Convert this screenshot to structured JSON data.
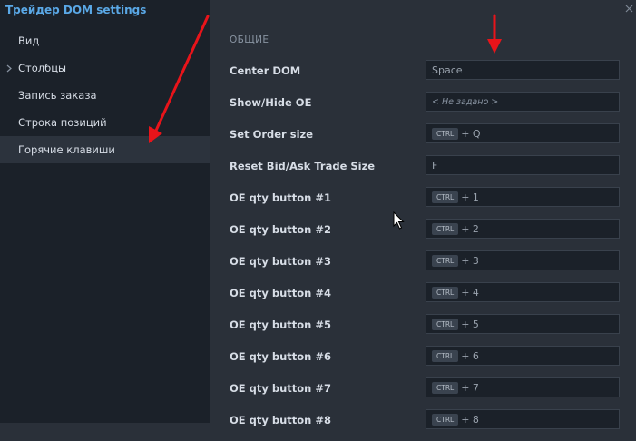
{
  "window": {
    "title": "Трейдер DOM settings"
  },
  "sidebar": {
    "items": [
      {
        "label": "Вид"
      },
      {
        "label": "Столбцы",
        "expandable": true
      },
      {
        "label": "Запись заказа"
      },
      {
        "label": "Строка позиций"
      },
      {
        "label": "Горячие клавиши",
        "active": true
      }
    ]
  },
  "main": {
    "section_title": "ОБЩИЕ",
    "settings": [
      {
        "label": "Center DOM",
        "value": "Space"
      },
      {
        "label": "Show/Hide OE",
        "placeholder": "< Не задано >"
      },
      {
        "label": "Set Order size",
        "modifier": "CTRL",
        "key": "+ Q"
      },
      {
        "label": "Reset Bid/Ask Trade Size",
        "value": "F"
      },
      {
        "label": "OE qty button #1",
        "modifier": "CTRL",
        "key": "+ 1"
      },
      {
        "label": "OE qty button #2",
        "modifier": "CTRL",
        "key": "+ 2"
      },
      {
        "label": "OE qty button #3",
        "modifier": "CTRL",
        "key": "+ 3"
      },
      {
        "label": "OE qty button #4",
        "modifier": "CTRL",
        "key": "+ 4"
      },
      {
        "label": "OE qty button #5",
        "modifier": "CTRL",
        "key": "+ 5"
      },
      {
        "label": "OE qty button #6",
        "modifier": "CTRL",
        "key": "+ 6"
      },
      {
        "label": "OE qty button #7",
        "modifier": "CTRL",
        "key": "+ 7"
      },
      {
        "label": "OE qty button #8",
        "modifier": "CTRL",
        "key": "+ 8"
      }
    ]
  },
  "colors": {
    "sidebar_bg": "#1b2129",
    "main_bg": "#2a3039",
    "title_accent": "#5aa8e6",
    "field_bg": "#1b2129",
    "annotation_arrow": "#e8141a"
  },
  "icons": [
    "chevron-right-icon",
    "close-icon",
    "mouse-cursor-icon",
    "red-arrow-annotation"
  ]
}
